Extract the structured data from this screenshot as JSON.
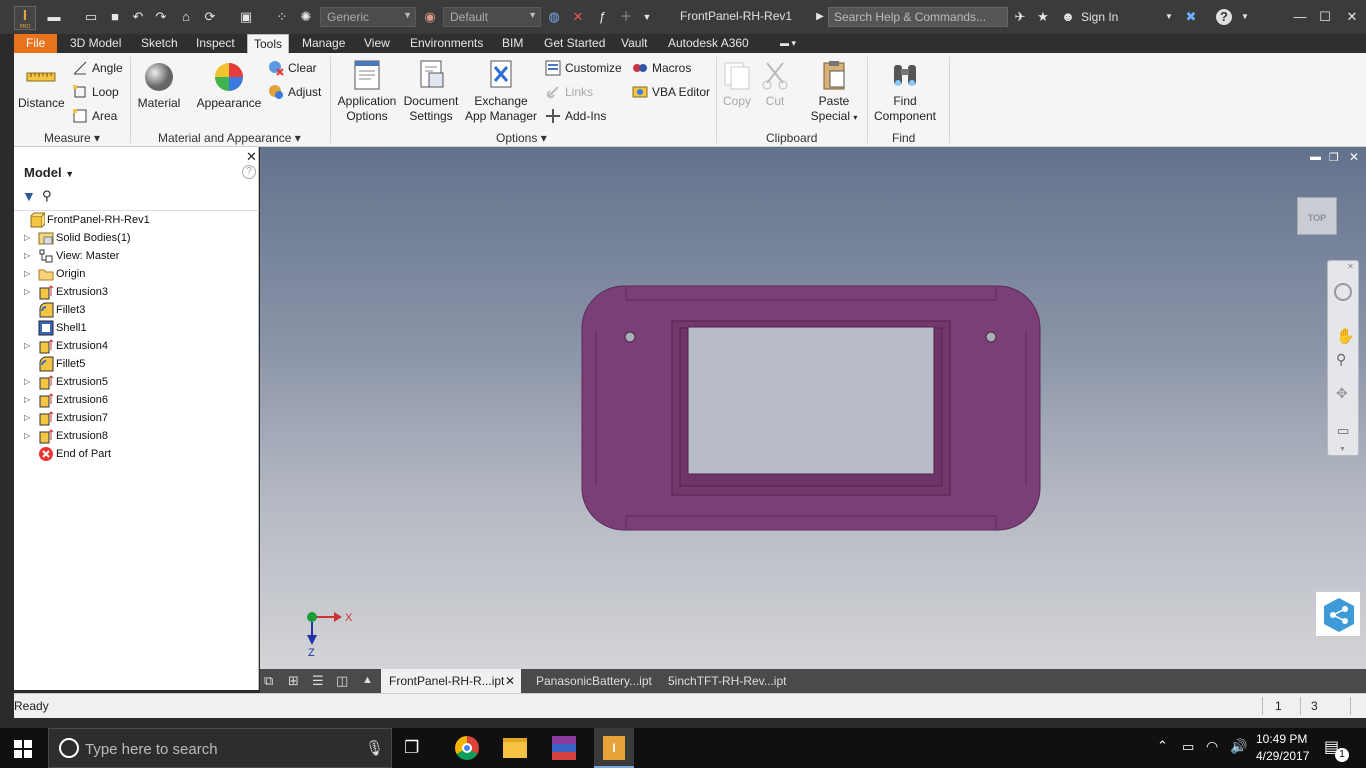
{
  "app": {
    "window_title": "FrontPanel-RH-Rev1",
    "app_icon_label": "I",
    "sign_in": "Sign In",
    "search_placeholder": "Search Help & Commands...",
    "material_combo": "Generic",
    "appearance_combo": "Default"
  },
  "menu_tabs": [
    {
      "label": "File"
    },
    {
      "label": "3D Model"
    },
    {
      "label": "Sketch"
    },
    {
      "label": "Inspect"
    },
    {
      "label": "Tools"
    },
    {
      "label": "Manage"
    },
    {
      "label": "View"
    },
    {
      "label": "Environments"
    },
    {
      "label": "BIM"
    },
    {
      "label": "Get Started"
    },
    {
      "label": "Vault"
    },
    {
      "label": "Autodesk A360"
    }
  ],
  "ribbon": {
    "measure": {
      "distance": "Distance",
      "angle": "Angle",
      "loop": "Loop",
      "area": "Area",
      "group": "Measure"
    },
    "material_appearance": {
      "material": "Material",
      "appearance": "Appearance",
      "clear": "Clear",
      "adjust": "Adjust",
      "group": "Material and Appearance"
    },
    "options": {
      "application_options": [
        "Application",
        "Options"
      ],
      "document_settings": [
        "Document",
        "Settings"
      ],
      "exchange": [
        "Exchange",
        "App Manager"
      ],
      "customize": "Customize",
      "links": "Links",
      "addins": "Add-Ins",
      "macros": "Macros",
      "vba": "VBA Editor",
      "group": "Options"
    },
    "clipboard": {
      "copy": "Copy",
      "cut": "Cut",
      "paste_special": [
        "Paste",
        "Special"
      ],
      "group": "Clipboard"
    },
    "find": {
      "find_component": [
        "Find",
        "Component"
      ],
      "group": "Find"
    }
  },
  "browser": {
    "title": "Model",
    "tree": [
      {
        "label": "FrontPanel-RH-Rev1",
        "icon": "part-icon",
        "expandable": false,
        "root": true
      },
      {
        "label": "Solid Bodies(1)",
        "icon": "solid-bodies-icon",
        "expandable": true
      },
      {
        "label": "View: Master",
        "icon": "view-icon",
        "expandable": true
      },
      {
        "label": "Origin",
        "icon": "folder-icon",
        "expandable": true
      },
      {
        "label": "Extrusion3",
        "icon": "extrusion-icon",
        "expandable": true
      },
      {
        "label": "Fillet3",
        "icon": "fillet-icon",
        "expandable": false
      },
      {
        "label": "Shell1",
        "icon": "shell-icon",
        "expandable": false
      },
      {
        "label": "Extrusion4",
        "icon": "extrusion-icon",
        "expandable": true
      },
      {
        "label": "Fillet5",
        "icon": "fillet-icon",
        "expandable": false
      },
      {
        "label": "Extrusion5",
        "icon": "extrusion-icon",
        "expandable": true
      },
      {
        "label": "Extrusion6",
        "icon": "extrusion-icon",
        "expandable": true
      },
      {
        "label": "Extrusion7",
        "icon": "extrusion-icon",
        "expandable": true
      },
      {
        "label": "Extrusion8",
        "icon": "extrusion-icon",
        "expandable": true
      },
      {
        "label": "End of Part",
        "icon": "end-of-part-icon",
        "expandable": false
      }
    ]
  },
  "viewport": {
    "viewcube_label": "TOP",
    "axis_x": "X",
    "axis_z": "Z",
    "part_color": "#7a3f76"
  },
  "doc_tabs": [
    {
      "label": "FrontPanel-RH-R...ipt",
      "active": true
    },
    {
      "label": "PanasonicBattery...ipt",
      "active": false
    },
    {
      "label": "5inchTFT-RH-Rev...ipt",
      "active": false
    }
  ],
  "status": {
    "text": "Ready",
    "count1": "1",
    "count2": "3"
  },
  "taskbar": {
    "search_placeholder": "Type here to search",
    "time": "10:49 PM",
    "date": "4/29/2017",
    "notif_count": "1"
  }
}
